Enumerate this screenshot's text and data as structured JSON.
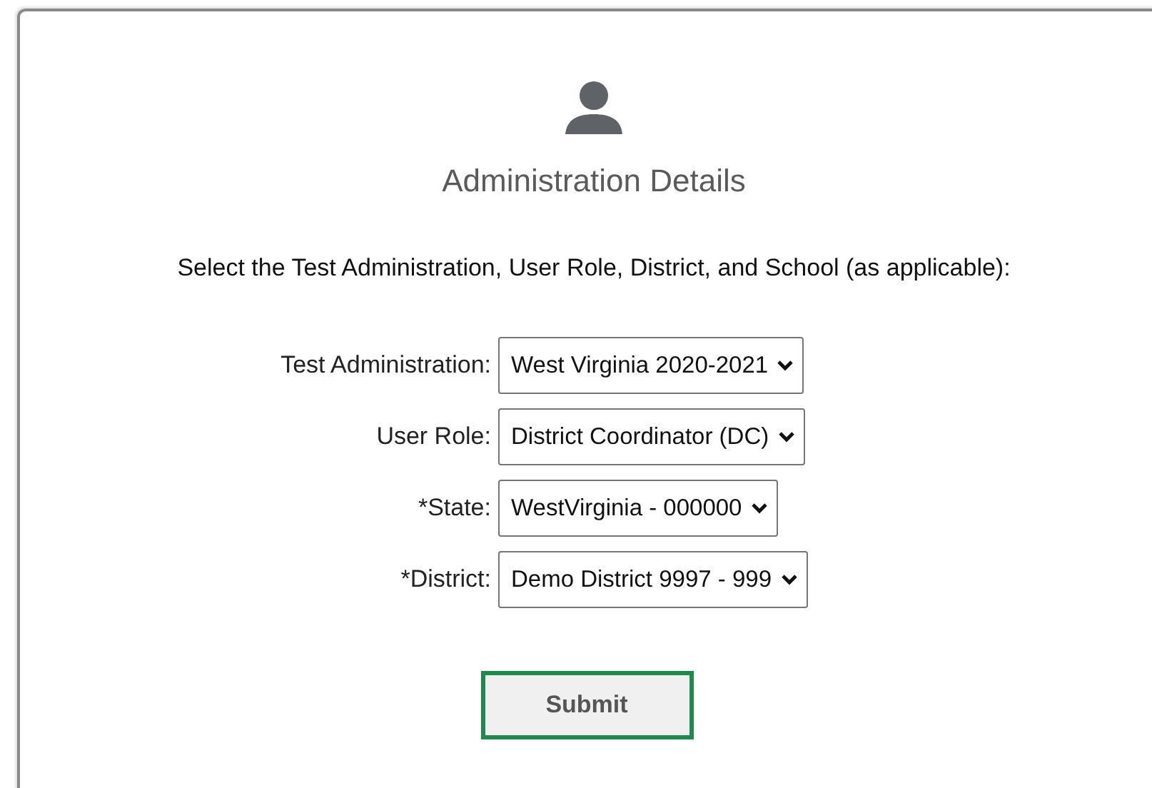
{
  "title": "Administration Details",
  "instructions": "Select the Test Administration, User Role, District, and School (as applicable):",
  "fields": [
    {
      "label": "Test Administration:",
      "value": "West Virginia 2020-2021"
    },
    {
      "label": "User Role:",
      "value": "District Coordinator (DC)"
    },
    {
      "label": "*State:",
      "value": "WestVirginia - 000000"
    },
    {
      "label": "*District:",
      "value": "Demo District 9997 - 999"
    }
  ],
  "submit": "Submit"
}
